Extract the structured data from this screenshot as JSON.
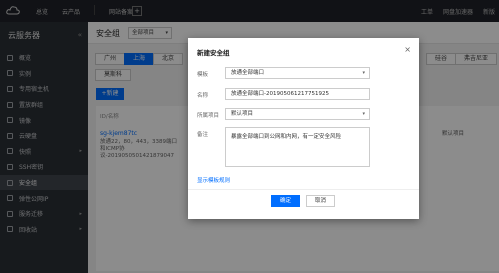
{
  "topbar": {
    "nav": [
      "总览",
      "云产品",
      "网站备案"
    ],
    "plus": "+",
    "right": [
      "工单",
      "网盘加速器",
      "新版"
    ]
  },
  "sidebar": {
    "title": "云服务器",
    "collapse": "«",
    "items": [
      {
        "label": "概览",
        "arrow": ""
      },
      {
        "label": "实例",
        "arrow": ""
      },
      {
        "label": "专用宿主机",
        "arrow": ""
      },
      {
        "label": "置放群组",
        "arrow": ""
      },
      {
        "label": "镜像",
        "arrow": ""
      },
      {
        "label": "云硬盘",
        "arrow": ""
      },
      {
        "label": "快照",
        "arrow": "▸"
      },
      {
        "label": "SSH密钥",
        "arrow": ""
      },
      {
        "label": "安全组",
        "arrow": ""
      },
      {
        "label": "弹性公网IP",
        "arrow": ""
      },
      {
        "label": "服务迁移",
        "arrow": "▸"
      },
      {
        "label": "回收站",
        "arrow": "▸"
      }
    ],
    "active_index": 8
  },
  "main": {
    "title": "安全组",
    "project": "全部项目",
    "regions": [
      "广州",
      "上海",
      "北京"
    ],
    "active_region": 1,
    "regions_right": [
      "硅谷",
      "弗吉尼亚"
    ],
    "region2": "莫斯科",
    "new_button": "+新建",
    "table_header": "ID/名称",
    "row": {
      "id": "sg-kjem87tc",
      "desc": "放通22，80，443，3389端口和ICMP协议-2019050501421879047",
      "right1": "1",
      "right2": "2019-05-06 21:59:51"
    },
    "right_col": "默认项目"
  },
  "modal": {
    "title": "新建安全组",
    "close": "×",
    "fields": [
      {
        "label": "模板",
        "value": "放通全部端口"
      },
      {
        "label": "名称",
        "value": "放通全部端口-2019050612177519​25"
      },
      {
        "label": "所属项目",
        "value": "默认项目"
      },
      {
        "label": "备注",
        "value": "暴露全部端口到公网和内网，有一定安全风险"
      }
    ],
    "link": "显示模板规则",
    "ok": "确定",
    "cancel": "取消"
  }
}
